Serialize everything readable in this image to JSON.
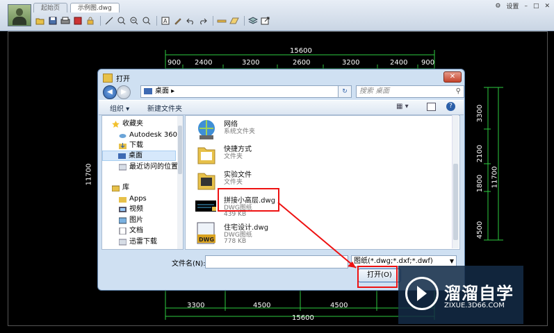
{
  "app": {
    "tabs": [
      "起始页",
      "示例图.dwg"
    ],
    "settings_label": "设置",
    "toolbar_icons": [
      "open-icon",
      "save-icon",
      "print-icon",
      "pdf-icon",
      "lock-icon",
      "measure-icon",
      "zoom-in-icon",
      "zoom-out-icon",
      "zoom-window-icon",
      "text-icon",
      "draw-icon",
      "undo-icon",
      "redo-icon",
      "layer-icon",
      "layout-icon",
      "layers-icon",
      "export-icon"
    ]
  },
  "drawing": {
    "top_total": "15600",
    "top_dims": [
      "900",
      "2400",
      "3200",
      "2600",
      "3200",
      "2400",
      "900"
    ],
    "bottom_dims": [
      "3300",
      "4500",
      "4500"
    ],
    "bottom_total": "15600",
    "left_height": "11700",
    "right_dims": [
      "3300",
      "2100",
      "1800",
      "4500"
    ],
    "right_total": "11700"
  },
  "dialog": {
    "title": "打开",
    "close_label": "✕",
    "address_location": "桌面",
    "search_placeholder": "搜索 桌面",
    "organize_label": "组织 ▾",
    "new_folder_label": "新建文件夹",
    "nav_items": [
      {
        "label": "收藏夹",
        "icon": "star-icon"
      },
      {
        "label": "Autodesk 360",
        "icon": "cloud-icon"
      },
      {
        "label": "下载",
        "icon": "download-folder-icon"
      },
      {
        "label": "桌面",
        "icon": "desktop-icon"
      },
      {
        "label": "最近访问的位置",
        "icon": "recent-places-icon"
      },
      {
        "label": "库",
        "icon": "library-icon"
      },
      {
        "label": "Apps",
        "icon": "folder-icon"
      },
      {
        "label": "视频",
        "icon": "video-icon"
      },
      {
        "label": "图片",
        "icon": "pictures-icon"
      },
      {
        "label": "文档",
        "icon": "documents-icon"
      },
      {
        "label": "迅雷下载",
        "icon": "thunder-download-icon"
      }
    ],
    "files": [
      {
        "name": "网络",
        "type": "系统文件夹",
        "size": "",
        "icon": "network-icon"
      },
      {
        "name": "快捷方式",
        "type": "文件夹",
        "size": "",
        "icon": "folder-icon"
      },
      {
        "name": "实验文件",
        "type": "文件夹",
        "size": "",
        "icon": "folder-icon"
      },
      {
        "name": "拼接小高层.dwg",
        "type": "DWG图纸",
        "size": "439 KB",
        "icon": "dwg-thumbnail-icon"
      },
      {
        "name": "住宅设计.dwg",
        "type": "DWG图纸",
        "size": "778 KB",
        "icon": "dwg-file-icon"
      }
    ],
    "filename_label": "文件名(N):",
    "filename_value": "",
    "filter_value": "图纸(*.dwg;*.dxf;*.dwf)",
    "open_button_label": "打开(O)"
  },
  "watermark": {
    "brand": "溜溜自学",
    "url": "ZIXUE.3D66.COM"
  },
  "colors": {
    "dim_line": "#2ecc40",
    "highlight_box": "#ee1111",
    "dialog_bg": "#cfe0f2"
  }
}
